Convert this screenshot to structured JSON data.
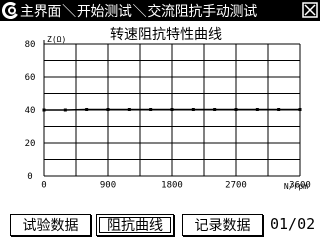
{
  "titlebar": {
    "crumbs": [
      "主界面",
      "开始测试",
      "交流阻抗手动测试"
    ],
    "separator": "＼",
    "logo_icon": "c-logo-icon",
    "close_icon": "close-box-icon"
  },
  "chart_data": {
    "type": "line",
    "title": "转速阻抗特性曲线",
    "ylabel": "Z(Ω)",
    "xlabel": "N/rpm",
    "xlim": [
      0,
      3600
    ],
    "ylim": [
      0,
      80
    ],
    "x_ticks": [
      "0",
      "900",
      "1800",
      "2700",
      "3600"
    ],
    "y_ticks": [
      "0",
      "20",
      "40",
      "60",
      "80"
    ],
    "x_tick_values": [
      0,
      900,
      1800,
      2700,
      3600
    ],
    "y_tick_values": [
      0,
      20,
      40,
      60,
      80
    ],
    "grid": true,
    "series": [
      {
        "x": [
          0,
          300,
          600,
          900,
          1200,
          1500,
          1800,
          2100,
          2400,
          2700,
          3000,
          3300,
          3600
        ],
        "y": [
          40,
          40,
          40.3,
          40.3,
          40.3,
          40.3,
          40.3,
          40.3,
          40.3,
          40.3,
          40.3,
          40.3,
          40.3
        ]
      }
    ]
  },
  "buttons": {
    "test_data": "试验数据",
    "impedance_curve": "阻抗曲线",
    "record_data": "记录数据"
  },
  "page_indicator": "01/02"
}
